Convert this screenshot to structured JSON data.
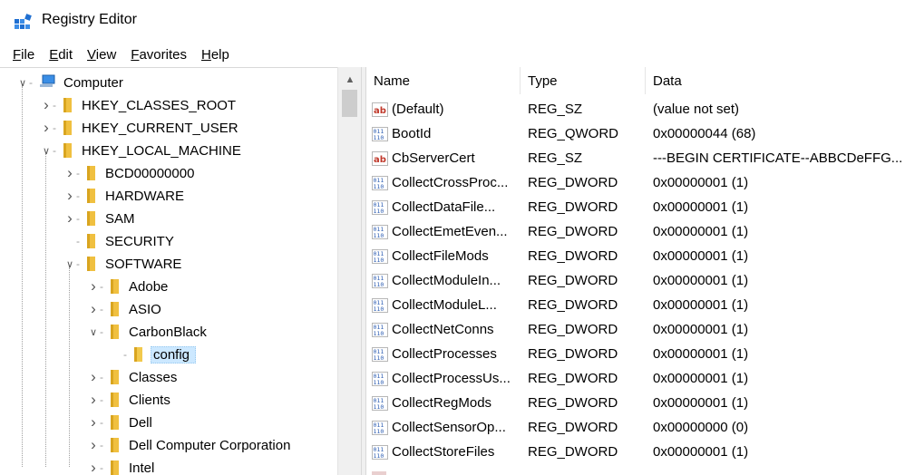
{
  "window": {
    "title": "Registry Editor"
  },
  "menu": [
    "File",
    "Edit",
    "View",
    "Favorites",
    "Help"
  ],
  "tree": [
    {
      "label": "Computer",
      "level": 0,
      "state": "expanded",
      "icon": "computer-icon"
    },
    {
      "label": "HKEY_CLASSES_ROOT",
      "level": 1,
      "state": "collapsed",
      "icon": "folder-icon"
    },
    {
      "label": "HKEY_CURRENT_USER",
      "level": 1,
      "state": "collapsed",
      "icon": "folder-icon"
    },
    {
      "label": "HKEY_LOCAL_MACHINE",
      "level": 1,
      "state": "expanded",
      "icon": "folder-icon"
    },
    {
      "label": "BCD00000000",
      "level": 2,
      "state": "collapsed",
      "icon": "folder-icon"
    },
    {
      "label": "HARDWARE",
      "level": 2,
      "state": "collapsed",
      "icon": "folder-icon"
    },
    {
      "label": "SAM",
      "level": 2,
      "state": "collapsed",
      "icon": "folder-icon"
    },
    {
      "label": "SECURITY",
      "level": 2,
      "state": "leaf",
      "icon": "folder-icon"
    },
    {
      "label": "SOFTWARE",
      "level": 2,
      "state": "expanded",
      "icon": "folder-icon"
    },
    {
      "label": "Adobe",
      "level": 3,
      "state": "collapsed",
      "icon": "folder-icon"
    },
    {
      "label": "ASIO",
      "level": 3,
      "state": "collapsed",
      "icon": "folder-icon"
    },
    {
      "label": "CarbonBlack",
      "level": 3,
      "state": "expanded",
      "icon": "folder-icon"
    },
    {
      "label": "config",
      "level": 4,
      "state": "leaf",
      "icon": "folder-icon",
      "selected": true
    },
    {
      "label": "Classes",
      "level": 3,
      "state": "collapsed",
      "icon": "folder-icon"
    },
    {
      "label": "Clients",
      "level": 3,
      "state": "collapsed",
      "icon": "folder-icon"
    },
    {
      "label": "Dell",
      "level": 3,
      "state": "collapsed",
      "icon": "folder-icon"
    },
    {
      "label": "Dell Computer Corporation",
      "level": 3,
      "state": "collapsed",
      "icon": "folder-icon"
    },
    {
      "label": "Intel",
      "level": 3,
      "state": "collapsed",
      "icon": "folder-icon"
    }
  ],
  "columns": {
    "name": "Name",
    "type": "Type",
    "data": "Data"
  },
  "values": [
    {
      "icon": "string-value-icon",
      "name": "(Default)",
      "type": "REG_SZ",
      "data": "(value not set)"
    },
    {
      "icon": "binary-value-icon",
      "name": "BootId",
      "type": "REG_QWORD",
      "data": "0x00000044 (68)"
    },
    {
      "icon": "string-value-icon",
      "name": "CbServerCert",
      "type": "REG_SZ",
      "data": "---BEGIN CERTIFICATE--ABBCDeFFG..."
    },
    {
      "icon": "binary-value-icon",
      "name": "CollectCrossProc...",
      "type": "REG_DWORD",
      "data": "0x00000001 (1)"
    },
    {
      "icon": "binary-value-icon",
      "name": "CollectDataFile...",
      "type": "REG_DWORD",
      "data": "0x00000001 (1)"
    },
    {
      "icon": "binary-value-icon",
      "name": "CollectEmetEven...",
      "type": "REG_DWORD",
      "data": "0x00000001 (1)"
    },
    {
      "icon": "binary-value-icon",
      "name": "CollectFileMods",
      "type": "REG_DWORD",
      "data": "0x00000001 (1)"
    },
    {
      "icon": "binary-value-icon",
      "name": "CollectModuleIn...",
      "type": "REG_DWORD",
      "data": "0x00000001 (1)"
    },
    {
      "icon": "binary-value-icon",
      "name": "CollectModuleL...",
      "type": "REG_DWORD",
      "data": "0x00000001 (1)"
    },
    {
      "icon": "binary-value-icon",
      "name": "CollectNetConns",
      "type": "REG_DWORD",
      "data": "0x00000001 (1)"
    },
    {
      "icon": "binary-value-icon",
      "name": "CollectProcesses",
      "type": "REG_DWORD",
      "data": "0x00000001 (1)"
    },
    {
      "icon": "binary-value-icon",
      "name": "CollectProcessUs...",
      "type": "REG_DWORD",
      "data": "0x00000001 (1)"
    },
    {
      "icon": "binary-value-icon",
      "name": "CollectRegMods",
      "type": "REG_DWORD",
      "data": "0x00000001 (1)"
    },
    {
      "icon": "binary-value-icon",
      "name": "CollectSensorOp...",
      "type": "REG_DWORD",
      "data": "0x00000000 (0)"
    },
    {
      "icon": "binary-value-icon",
      "name": "CollectStoreFiles",
      "type": "REG_DWORD",
      "data": "0x00000001 (1)"
    }
  ],
  "colors": {
    "selection": "#cce8ff",
    "folder": "#f0c040",
    "string_icon": "#c0392b",
    "binary_icon": "#2f5fb3"
  }
}
